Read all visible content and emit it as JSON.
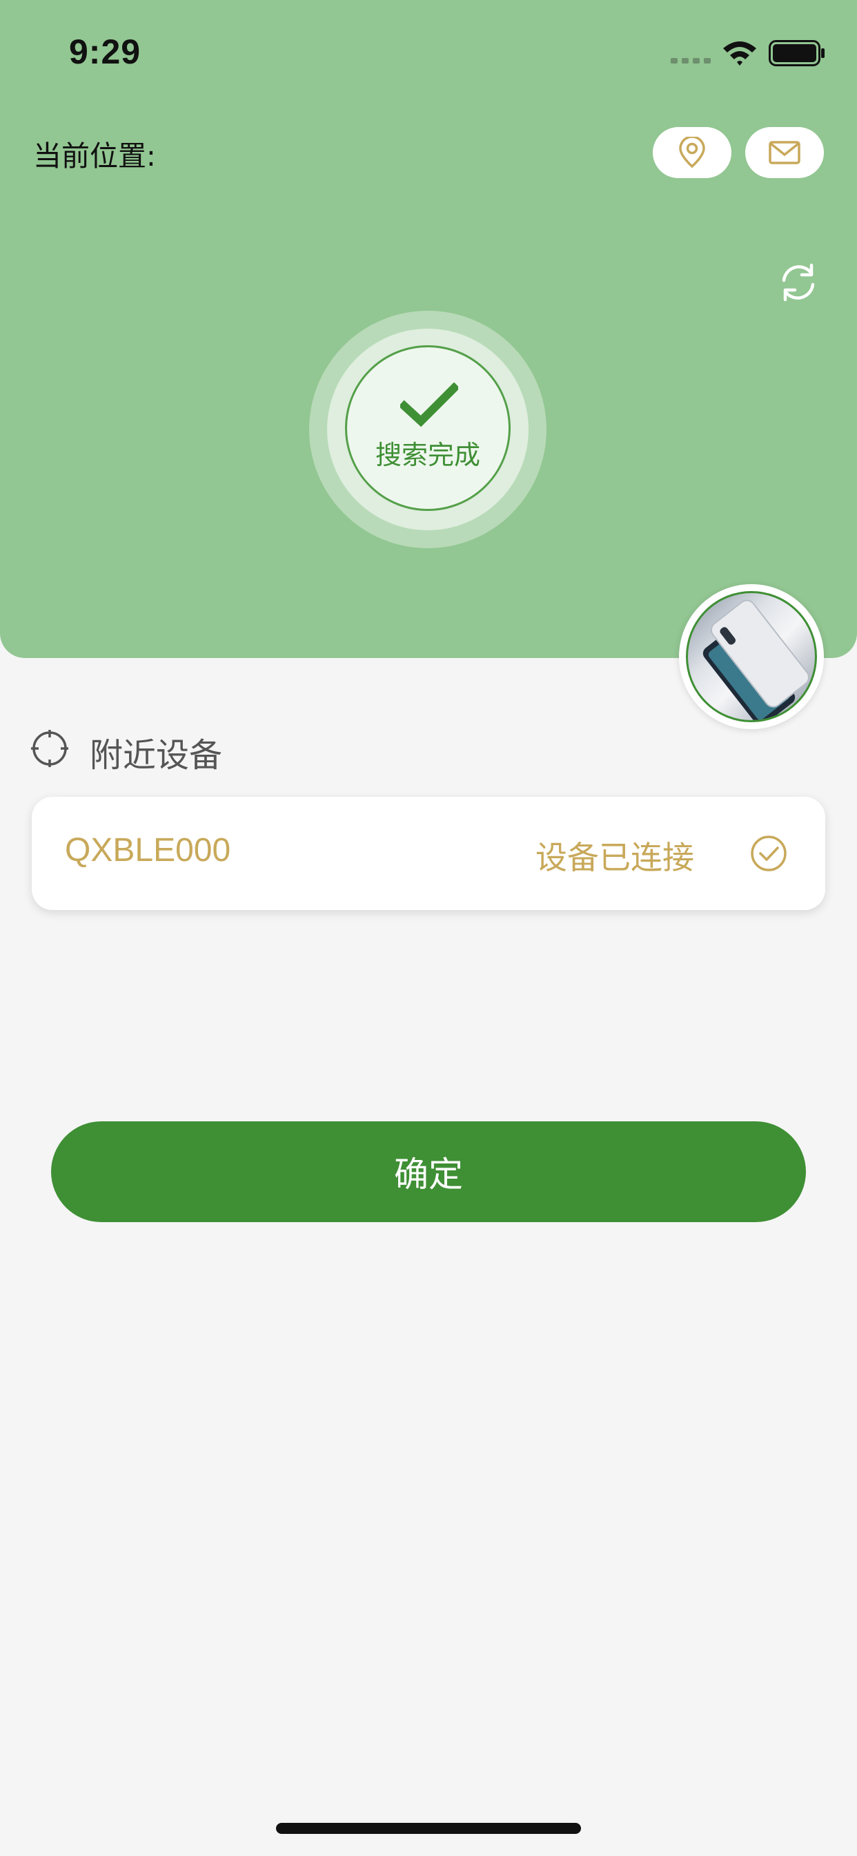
{
  "status_bar": {
    "time": "9:29"
  },
  "header": {
    "location_label": "当前位置:",
    "search_status": "搜索完成",
    "background_color": "#92c692",
    "icons": {
      "location": "location-pin-icon",
      "mail": "mail-icon",
      "refresh": "refresh-icon",
      "search_done": "checkmark-icon"
    }
  },
  "nearby": {
    "title": "附近设备",
    "icon": "crosshair-icon",
    "devices": [
      {
        "name": "QXBLE000",
        "status": "设备已连接",
        "status_icon": "check-circle-icon"
      }
    ]
  },
  "actions": {
    "confirm_label": "确定",
    "accent_color": "#3f8f35",
    "gold_color": "#c8a95a"
  }
}
